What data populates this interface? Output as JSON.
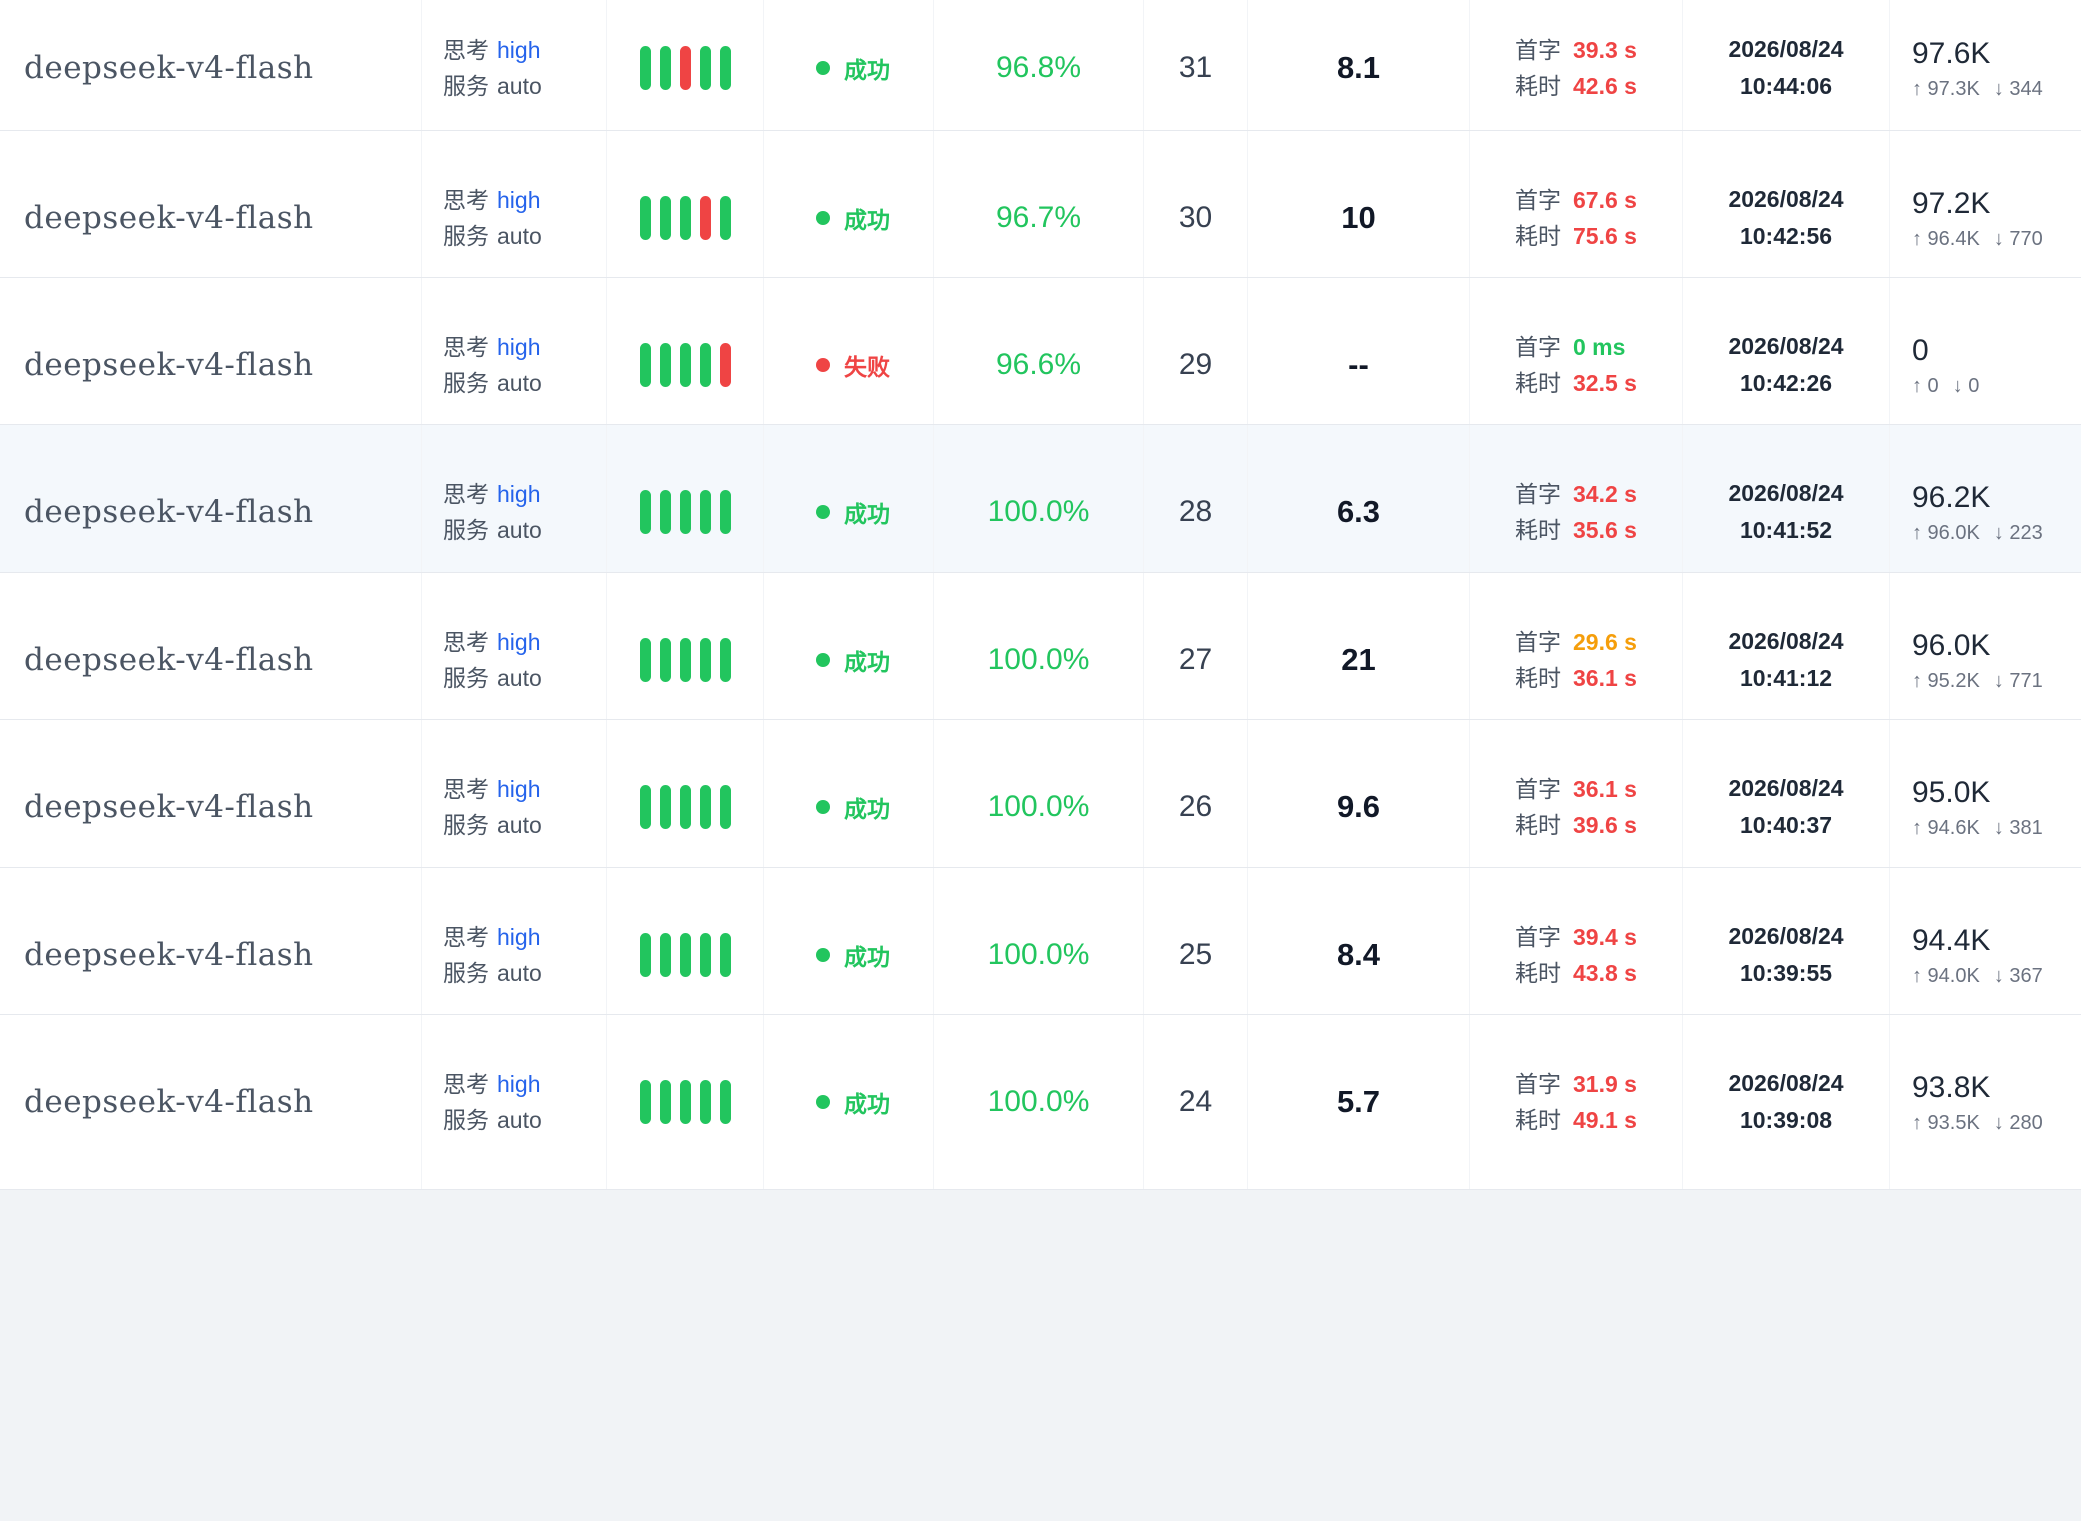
{
  "labels": {
    "think": "思考",
    "service": "服务",
    "first_token": "首字",
    "duration": "耗时"
  },
  "colors": {
    "success": "#22c55e",
    "fail": "#ef4444",
    "warn": "#f59e0b",
    "think_value": "#2563eb"
  },
  "rows": [
    {
      "model": "deepseek-v4-flash",
      "think": "high",
      "service": "auto",
      "bars": [
        "ok",
        "ok",
        "fail",
        "ok",
        "ok"
      ],
      "status": "成功",
      "status_type": "ok",
      "success_rate": "96.8%",
      "number": "31",
      "score": "8.1",
      "first_token": "39.3 s",
      "first_color": "#ef4444",
      "duration": "42.6 s",
      "duration_color": "#ef4444",
      "date": "2026/08/24",
      "time": "10:44:06",
      "tokens_total": "97.6K",
      "tokens_in": "↑ 97.3K",
      "tokens_out": "↓ 344",
      "highlight": false
    },
    {
      "model": "deepseek-v4-flash",
      "think": "high",
      "service": "auto",
      "bars": [
        "ok",
        "ok",
        "ok",
        "fail",
        "ok"
      ],
      "status": "成功",
      "status_type": "ok",
      "success_rate": "96.7%",
      "number": "30",
      "score": "10",
      "first_token": "67.6 s",
      "first_color": "#ef4444",
      "duration": "75.6 s",
      "duration_color": "#ef4444",
      "date": "2026/08/24",
      "time": "10:42:56",
      "tokens_total": "97.2K",
      "tokens_in": "↑ 96.4K",
      "tokens_out": "↓ 770",
      "highlight": false
    },
    {
      "model": "deepseek-v4-flash",
      "think": "high",
      "service": "auto",
      "bars": [
        "ok",
        "ok",
        "ok",
        "ok",
        "fail"
      ],
      "status": "失败",
      "status_type": "fail",
      "success_rate": "96.6%",
      "number": "29",
      "score": "--",
      "first_token": "0 ms",
      "first_color": "#22c55e",
      "duration": "32.5 s",
      "duration_color": "#ef4444",
      "date": "2026/08/24",
      "time": "10:42:26",
      "tokens_total": "0",
      "tokens_in": "↑ 0",
      "tokens_out": "↓ 0",
      "highlight": false
    },
    {
      "model": "deepseek-v4-flash",
      "think": "high",
      "service": "auto",
      "bars": [
        "ok",
        "ok",
        "ok",
        "ok",
        "ok"
      ],
      "status": "成功",
      "status_type": "ok",
      "success_rate": "100.0%",
      "number": "28",
      "score": "6.3",
      "first_token": "34.2 s",
      "first_color": "#ef4444",
      "duration": "35.6 s",
      "duration_color": "#ef4444",
      "date": "2026/08/24",
      "time": "10:41:52",
      "tokens_total": "96.2K",
      "tokens_in": "↑ 96.0K",
      "tokens_out": "↓ 223",
      "highlight": true
    },
    {
      "model": "deepseek-v4-flash",
      "think": "high",
      "service": "auto",
      "bars": [
        "ok",
        "ok",
        "ok",
        "ok",
        "ok"
      ],
      "status": "成功",
      "status_type": "ok",
      "success_rate": "100.0%",
      "number": "27",
      "score": "21",
      "first_token": "29.6 s",
      "first_color": "#f59e0b",
      "duration": "36.1 s",
      "duration_color": "#ef4444",
      "date": "2026/08/24",
      "time": "10:41:12",
      "tokens_total": "96.0K",
      "tokens_in": "↑ 95.2K",
      "tokens_out": "↓ 771",
      "highlight": false
    },
    {
      "model": "deepseek-v4-flash",
      "think": "high",
      "service": "auto",
      "bars": [
        "ok",
        "ok",
        "ok",
        "ok",
        "ok"
      ],
      "status": "成功",
      "status_type": "ok",
      "success_rate": "100.0%",
      "number": "26",
      "score": "9.6",
      "first_token": "36.1 s",
      "first_color": "#ef4444",
      "duration": "39.6 s",
      "duration_color": "#ef4444",
      "date": "2026/08/24",
      "time": "10:40:37",
      "tokens_total": "95.0K",
      "tokens_in": "↑ 94.6K",
      "tokens_out": "↓ 381",
      "highlight": false
    },
    {
      "model": "deepseek-v4-flash",
      "think": "high",
      "service": "auto",
      "bars": [
        "ok",
        "ok",
        "ok",
        "ok",
        "ok"
      ],
      "status": "成功",
      "status_type": "ok",
      "success_rate": "100.0%",
      "number": "25",
      "score": "8.4",
      "first_token": "39.4 s",
      "first_color": "#ef4444",
      "duration": "43.8 s",
      "duration_color": "#ef4444",
      "date": "2026/08/24",
      "time": "10:39:55",
      "tokens_total": "94.4K",
      "tokens_in": "↑ 94.0K",
      "tokens_out": "↓ 367",
      "highlight": false
    },
    {
      "model": "deepseek-v4-flash",
      "think": "high",
      "service": "auto",
      "bars": [
        "ok",
        "ok",
        "ok",
        "ok",
        "ok"
      ],
      "status": "成功",
      "status_type": "ok",
      "success_rate": "100.0%",
      "number": "24",
      "score": "5.7",
      "first_token": "31.9 s",
      "first_color": "#ef4444",
      "duration": "49.1 s",
      "duration_color": "#ef4444",
      "date": "2026/08/24",
      "time": "10:39:08",
      "tokens_total": "93.8K",
      "tokens_in": "↑ 93.5K",
      "tokens_out": "↓ 280",
      "highlight": false
    }
  ]
}
